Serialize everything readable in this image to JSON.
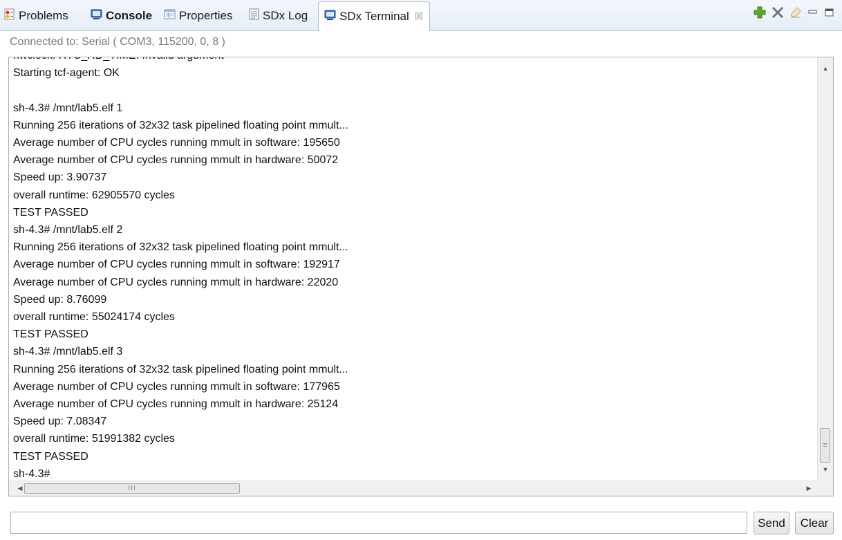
{
  "tabs": [
    {
      "label": "Problems",
      "icon": "problems-icon",
      "bold": false
    },
    {
      "label": "Console",
      "icon": "console-icon",
      "bold": true
    },
    {
      "label": "Properties",
      "icon": "properties-icon",
      "bold": false
    },
    {
      "label": "SDx Log",
      "icon": "log-icon",
      "bold": false
    },
    {
      "label": "SDx Terminal",
      "icon": "terminal-icon",
      "bold": false,
      "active": true
    }
  ],
  "toolbar": {
    "icons": [
      "add-terminal-icon",
      "remove-terminal-icon",
      "clear-icon",
      "minimize-icon",
      "maximize-icon"
    ]
  },
  "status": {
    "connection": "Connected to: Serial ( COM3, 115200, 0, 8 )"
  },
  "terminal": {
    "lines": [
      "hwclock: RTC_RD_TIME: Invalid argument",
      "Starting tcf-agent: OK",
      "",
      "sh-4.3# /mnt/lab5.elf 1",
      "Running 256 iterations of 32x32 task pipelined floating point mmult...",
      "Average number of CPU cycles running mmult in software: 195650",
      "Average number of CPU cycles running mmult in hardware: 50072",
      "Speed up: 3.90737",
      "overall runtime: 62905570 cycles",
      "TEST PASSED",
      "sh-4.3# /mnt/lab5.elf 2",
      "Running 256 iterations of 32x32 task pipelined floating point mmult...",
      "Average number of CPU cycles running mmult in software: 192917",
      "Average number of CPU cycles running mmult in hardware: 22020",
      "Speed up: 8.76099",
      "overall runtime: 55024174 cycles",
      "TEST PASSED",
      "sh-4.3# /mnt/lab5.elf 3",
      "Running 256 iterations of 32x32 task pipelined floating point mmult...",
      "Average number of CPU cycles running mmult in software: 177965",
      "Average number of CPU cycles running mmult in hardware: 25124",
      "Speed up: 7.08347",
      "overall runtime: 51991382 cycles",
      "TEST PASSED",
      "sh-4.3#"
    ]
  },
  "input": {
    "value": "",
    "send_label": "Send",
    "clear_label": "Clear"
  },
  "colors": {
    "tabbar_top": "#f3f7fc",
    "tabbar_bottom": "#e5edf7",
    "add_icon": "#5aa832",
    "remove_icon": "#707070"
  }
}
